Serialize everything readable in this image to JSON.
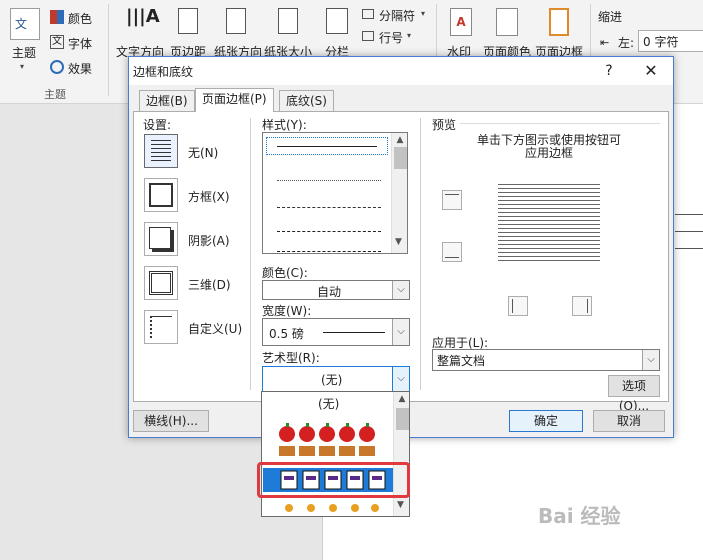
{
  "ribbon": {
    "theme_label": "主题",
    "colors_label": "颜色",
    "fonts_label": "字体",
    "effects_label": "效果",
    "group_label": "主题",
    "text_direction": "文字方向",
    "margins": "页边距",
    "orientation": "纸张方向",
    "size": "纸张大小",
    "columns": "分栏",
    "breaks": "分隔符",
    "line_numbers": "行号",
    "watermark": "水印",
    "page_color": "页面颜色",
    "page_borders": "页面边框",
    "indent": "缩进",
    "indent_left_label": "左:",
    "indent_left_value": "0 字符"
  },
  "dialog": {
    "title": "边框和底纹",
    "help": "?",
    "close": "✕",
    "tabs": [
      "边框(B)",
      "页面边框(P)",
      "底纹(S)"
    ],
    "active_tab": 1,
    "settings_label": "设置:",
    "settings": [
      {
        "label": "无(N)"
      },
      {
        "label": "方框(X)"
      },
      {
        "label": "阴影(A)"
      },
      {
        "label": "三维(D)"
      },
      {
        "label": "自定义(U)"
      }
    ],
    "style_label": "样式(Y):",
    "color_label": "颜色(C):",
    "color_value": "自动",
    "width_label": "宽度(W):",
    "width_value": "0.5 磅",
    "art_label": "艺术型(R):",
    "art_value": "(无)",
    "preview_label": "预览",
    "preview_hint": "单击下方图示或使用按钮可应用边框",
    "apply_label": "应用于(L):",
    "apply_value": "整篇文档",
    "options_button": "选项(O)...",
    "horizontal_line_button": "横线(H)...",
    "ok_button": "确定",
    "cancel_button": "取消"
  },
  "art_list": {
    "first_item": "(无)",
    "selected_index": 2
  },
  "watermark": "Bai 经验",
  "colors": {
    "accent": "#1e7bd8",
    "highlight": "#e0393e",
    "apple_red": "#d42020"
  }
}
